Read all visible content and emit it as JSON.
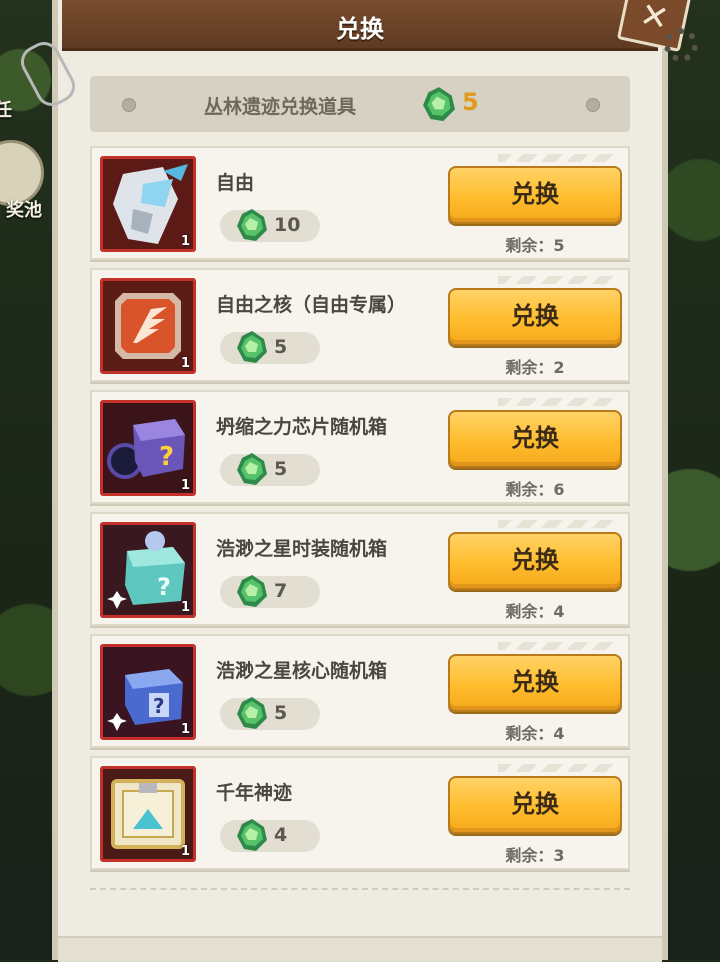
{
  "header": {
    "title": "兑换"
  },
  "side": {
    "label_top": "任",
    "label_pool": "奖池"
  },
  "subtitle": {
    "text": "丛林遗迹兑换道具",
    "currency_icon": "jungle-gem-icon",
    "currency_count": "5"
  },
  "items": [
    {
      "name": "自由",
      "cost": "10",
      "button": "兑换",
      "remaining": "剩余：5",
      "qty": "1",
      "icon": "mech-robot-icon"
    },
    {
      "name": "自由之核（自由专属）",
      "cost": "5",
      "button": "兑换",
      "remaining": "剩余：2",
      "qty": "1",
      "icon": "wing-emblem-core-icon"
    },
    {
      "name": "坍缩之力芯片随机箱",
      "cost": "5",
      "button": "兑换",
      "remaining": "剩余：6",
      "qty": "1",
      "icon": "purple-mystery-box-icon"
    },
    {
      "name": "浩渺之星时装随机箱",
      "cost": "7",
      "button": "兑换",
      "remaining": "剩余：4",
      "qty": "1",
      "icon": "teal-gift-box-icon"
    },
    {
      "name": "浩渺之星核心随机箱",
      "cost": "5",
      "button": "兑换",
      "remaining": "剩余：4",
      "qty": "1",
      "icon": "blue-mystery-box-icon"
    },
    {
      "name": "千年神迹",
      "cost": "4",
      "button": "兑换",
      "remaining": "剩余：3",
      "qty": "1",
      "icon": "ancient-chest-icon"
    }
  ],
  "colors": {
    "accent": "#ffbd2e",
    "header": "#6b4328",
    "currency": "#e29a1a",
    "frame": "#c4302a"
  }
}
